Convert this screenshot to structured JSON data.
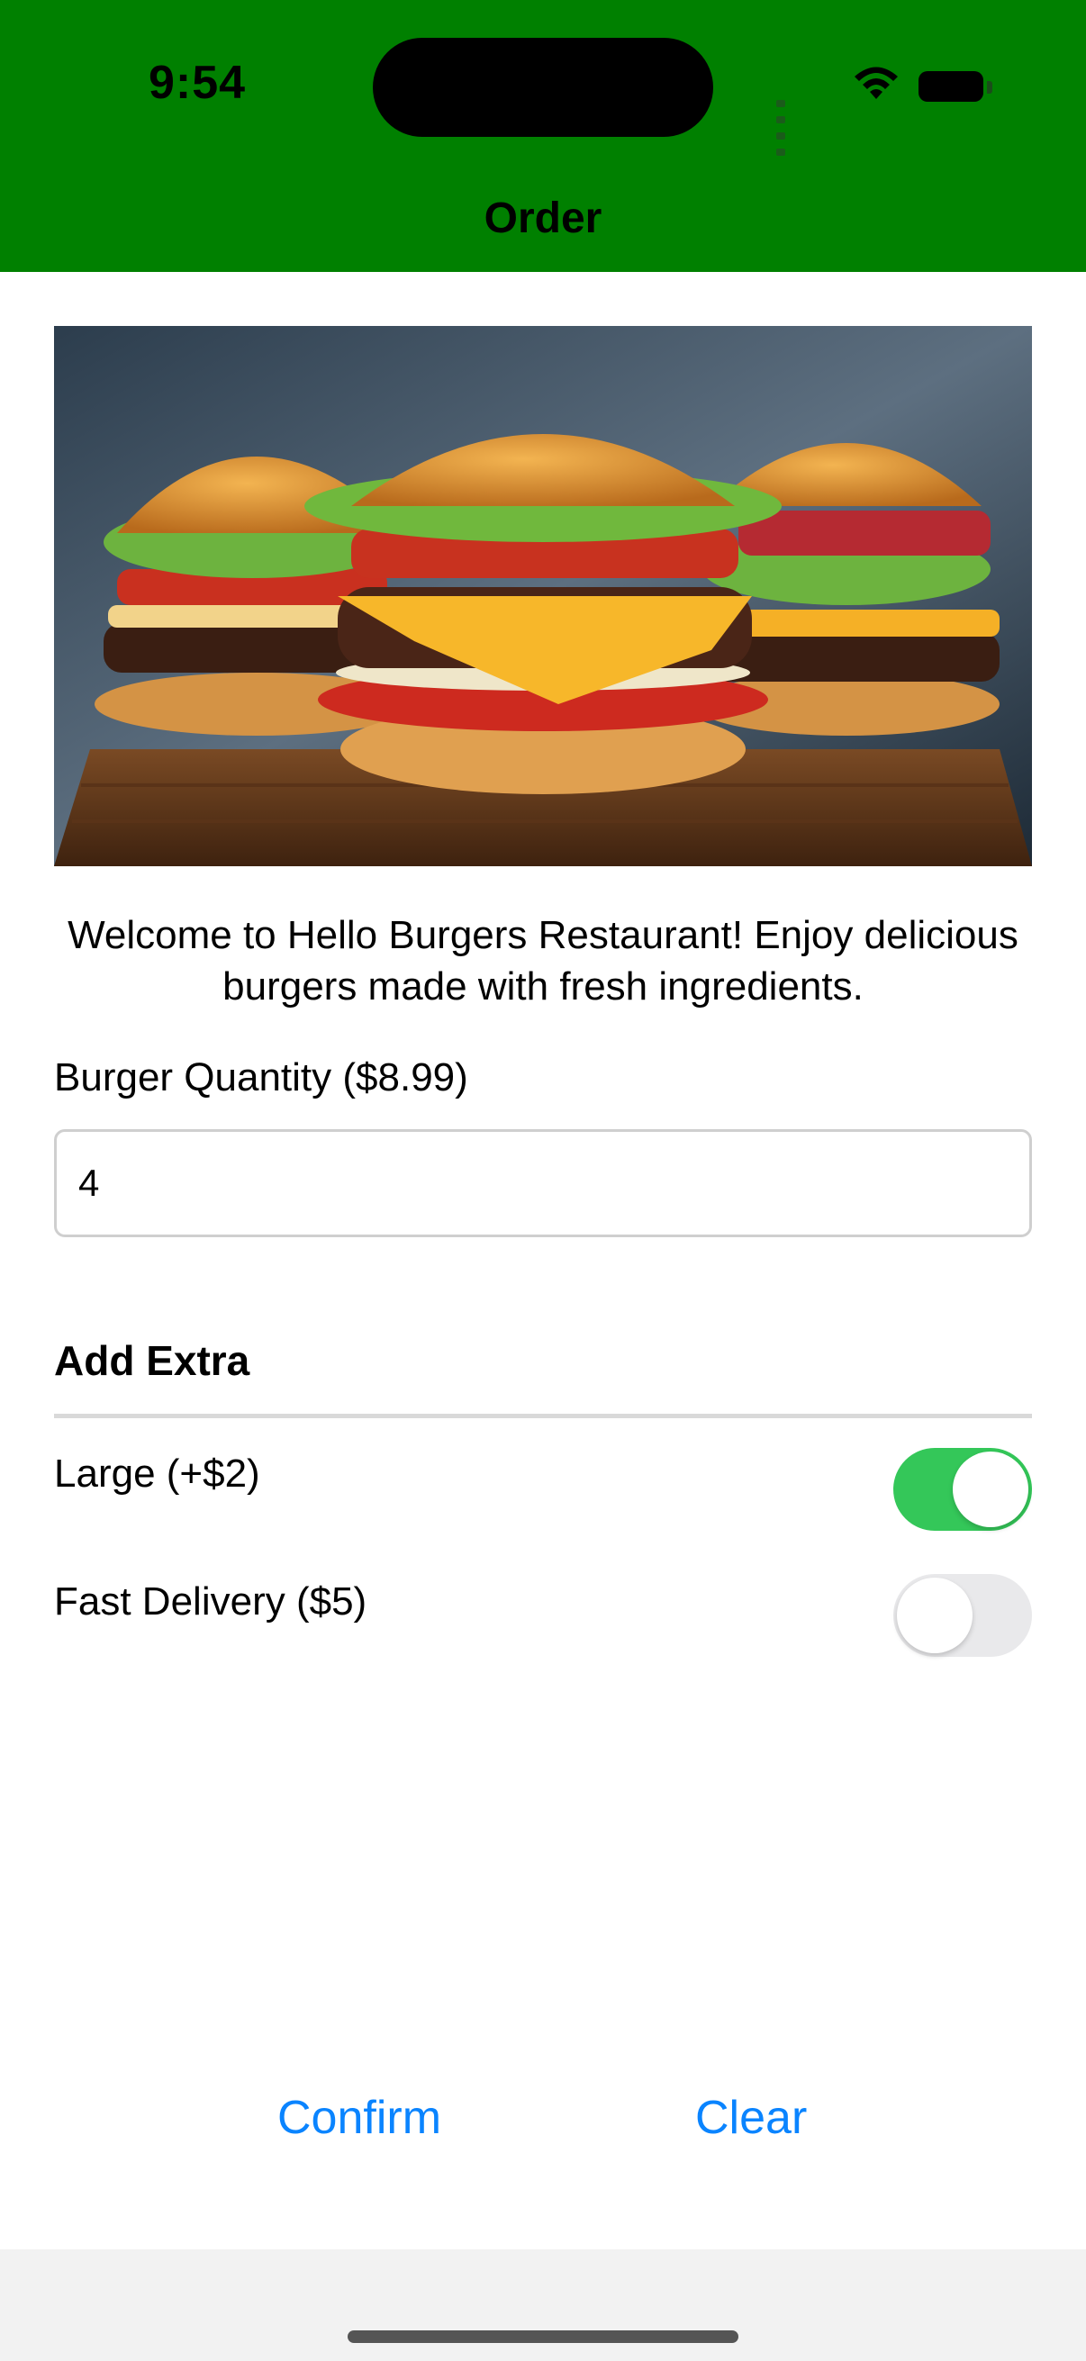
{
  "status_bar": {
    "time": "9:54"
  },
  "nav": {
    "title": "Order"
  },
  "hero_image": {
    "alt": "burgers-photo"
  },
  "welcome_text": "Welcome to Hello Burgers Restaurant! Enjoy delicious burgers made with fresh ingredients.",
  "quantity": {
    "label": "Burger Quantity ($8.99)",
    "value": "4"
  },
  "extras": {
    "title": "Add Extra",
    "large": {
      "label": "Large (+$2)",
      "on": true
    },
    "fast_delivery": {
      "label": "Fast Delivery ($5)",
      "on": false
    }
  },
  "actions": {
    "confirm": "Confirm",
    "clear": "Clear"
  },
  "colors": {
    "header": "#008000",
    "toggle_on": "#34c759",
    "link": "#0a84ff"
  }
}
